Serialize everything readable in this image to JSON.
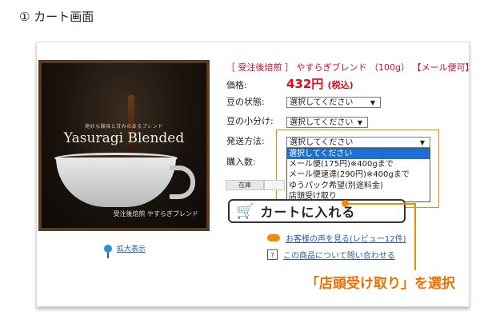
{
  "step": {
    "title": "① カート画面"
  },
  "image": {
    "tagline": "絶妙な酸味と甘みのあるブレンド",
    "brand": "Yasuragi Blended",
    "maker": "受注後焙煎 やすらぎブレンド",
    "zoom_label": "拡大表示"
  },
  "product": {
    "title": "［ 受注後焙煎 ］ やすらぎブレンド （100g） 【メール便可】",
    "price_label": "価格:",
    "price": "432円",
    "price_tax": "(税込)"
  },
  "options": {
    "bean_state_label": "豆の状態:",
    "bean_state_value": "選択してください",
    "bean_split_label": "豆の小分け:",
    "bean_split_value": "選択してください",
    "shipping_label": "発送方法:",
    "shipping_value": "選択してください",
    "quantity_label": "購入数:",
    "shipping_options": [
      "選択してください",
      "メール便(175円)※400gまで",
      "メール便速達(290円)※400gまで",
      "ゆうパック希望(別途料金)",
      "店頭受け取り"
    ],
    "dropdown_arrow": "▼"
  },
  "stock": {
    "label": "在庫"
  },
  "cart": {
    "button_label": "カートに入れる",
    "icon": "cart-icon"
  },
  "links": {
    "reviews": "お客様の声を見る(レビュー12件)",
    "inquiry": "この商品について問い合わせる",
    "inquiry_icon_text": "?"
  },
  "annotation": {
    "callout": "「店頭受け取り」を選択"
  },
  "colors": {
    "accent": "#f28a00",
    "price": "#e20a1a",
    "title_red": "#c8102e",
    "selected": "#1c6fd6"
  }
}
